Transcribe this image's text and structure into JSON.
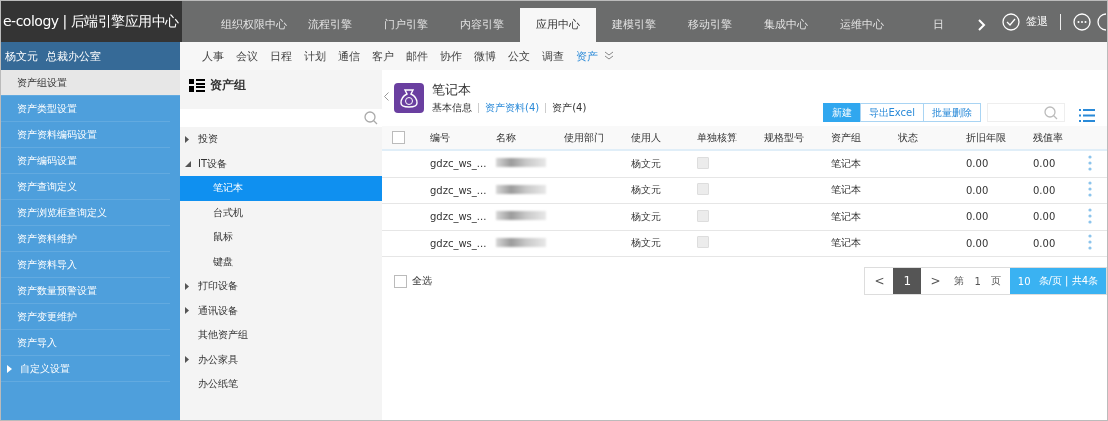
{
  "brand": "e-cology | 后端引擎应用中心",
  "top_tabs": [
    {
      "label": "组织权限中心",
      "selected": false
    },
    {
      "label": "流程引擎",
      "selected": false
    },
    {
      "label": "门户引擎",
      "selected": false
    },
    {
      "label": "内容引擎",
      "selected": false
    },
    {
      "label": "应用中心",
      "selected": true
    },
    {
      "label": "建模引擎",
      "selected": false
    },
    {
      "label": "移动引擎",
      "selected": false
    },
    {
      "label": "集成中心",
      "selected": false
    },
    {
      "label": "运维中心",
      "selected": false
    },
    {
      "label": "日",
      "selected": false
    }
  ],
  "sign_out": "签退",
  "user": {
    "name": "杨文元",
    "dept": "总裁办公室"
  },
  "sub_nav": [
    {
      "label": "人事",
      "selected": false
    },
    {
      "label": "会议",
      "selected": false
    },
    {
      "label": "日程",
      "selected": false
    },
    {
      "label": "计划",
      "selected": false
    },
    {
      "label": "通信",
      "selected": false
    },
    {
      "label": "客户",
      "selected": false
    },
    {
      "label": "邮件",
      "selected": false
    },
    {
      "label": "协作",
      "selected": false
    },
    {
      "label": "微博",
      "selected": false
    },
    {
      "label": "公文",
      "selected": false
    },
    {
      "label": "调查",
      "selected": false
    },
    {
      "label": "资产",
      "selected": true
    }
  ],
  "sidebar": [
    {
      "label": "资产组设置",
      "selected": true,
      "expandable": false
    },
    {
      "label": "资产类型设置",
      "selected": false,
      "expandable": false
    },
    {
      "label": "资产资料编码设置",
      "selected": false,
      "expandable": false
    },
    {
      "label": "资产编码设置",
      "selected": false,
      "expandable": false
    },
    {
      "label": "资产查询定义",
      "selected": false,
      "expandable": false
    },
    {
      "label": "资产浏览框查询定义",
      "selected": false,
      "expandable": false
    },
    {
      "label": "资产资料维护",
      "selected": false,
      "expandable": false
    },
    {
      "label": "资产资料导入",
      "selected": false,
      "expandable": false
    },
    {
      "label": "资产数量预警设置",
      "selected": false,
      "expandable": false
    },
    {
      "label": "资产变更维护",
      "selected": false,
      "expandable": false
    },
    {
      "label": "资产导入",
      "selected": false,
      "expandable": false
    },
    {
      "label": "自定义设置",
      "selected": false,
      "expandable": true
    }
  ],
  "tree": {
    "title": "资产组",
    "items": [
      {
        "label": "投资",
        "expandable": true,
        "expanded": false,
        "selected": false
      },
      {
        "label": "IT设备",
        "expandable": true,
        "expanded": true,
        "selected": false,
        "children": [
          {
            "label": "笔记本",
            "selected": true
          },
          {
            "label": "台式机",
            "selected": false
          },
          {
            "label": "鼠标",
            "selected": false
          },
          {
            "label": "键盘",
            "selected": false
          }
        ]
      },
      {
        "label": "打印设备",
        "expandable": true,
        "expanded": false,
        "selected": false
      },
      {
        "label": "通讯设备",
        "expandable": true,
        "expanded": false,
        "selected": false
      },
      {
        "label": "其他资产组",
        "expandable": false,
        "selected": false
      },
      {
        "label": "办公家具",
        "expandable": true,
        "expanded": false,
        "selected": false
      },
      {
        "label": "办公纸笔",
        "expandable": false,
        "selected": false
      }
    ]
  },
  "header": {
    "title": "笔记本",
    "tabs": [
      {
        "label": "基本信息",
        "selected": false
      },
      {
        "label": "资产资料(4)",
        "selected": true
      },
      {
        "label": "资产(4)",
        "selected": false
      }
    ],
    "buttons": [
      {
        "label": "新建",
        "primary": true
      },
      {
        "label": "导出Excel",
        "primary": false
      },
      {
        "label": "批量删除",
        "primary": false
      }
    ]
  },
  "table": {
    "all_checked": false,
    "columns": [
      "编号",
      "名称",
      "使用部门",
      "使用人",
      "单独核算",
      "规格型号",
      "资产组",
      "状态",
      "折旧年限",
      "残值率"
    ],
    "rows": [
      {
        "code": "gdzc_ws_...",
        "user": "杨文元",
        "separate": false,
        "group": "笔记本",
        "years": "0.00",
        "rate": "0.00"
      },
      {
        "code": "gdzc_ws_...",
        "user": "杨文元",
        "separate": false,
        "group": "笔记本",
        "years": "0.00",
        "rate": "0.00"
      },
      {
        "code": "gdzc_ws_...",
        "user": "杨文元",
        "separate": false,
        "group": "笔记本",
        "years": "0.00",
        "rate": "0.00"
      },
      {
        "code": "gdzc_ws_...",
        "user": "杨文元",
        "separate": false,
        "group": "笔记本",
        "years": "0.00",
        "rate": "0.00"
      }
    ]
  },
  "footer": {
    "select_all": "全选",
    "select_all_checked": false,
    "prev": "<",
    "page": "1",
    "next": ">",
    "page_prefix": "第",
    "page_no": "1",
    "page_suffix": "页",
    "page_size": "10",
    "summary": "条/页 | 共4条"
  }
}
